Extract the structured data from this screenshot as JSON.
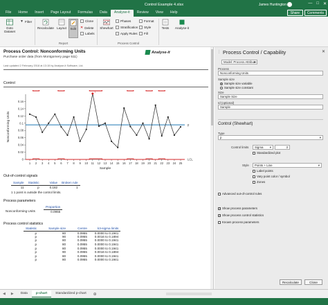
{
  "window": {
    "title": "Control Example 4.xlsx",
    "user": "James Huntington"
  },
  "ribbon_tabs": [
    "File",
    "Home",
    "Insert",
    "Page Layout",
    "Formulas",
    "Data",
    "Analyse-it",
    "Review",
    "View",
    "Help"
  ],
  "ribbon_share": "Share",
  "ribbon_comments": "Comments",
  "ribbon": {
    "goto_dataset": "Goto Dataset",
    "filter": "Filter",
    "recalculate": "Recalculate",
    "layout": "Layout",
    "edit": "Edit",
    "clone": "Clone",
    "delete": "Delete",
    "labels": "Labels",
    "report_group": "Report",
    "shewhart": "Shewhart",
    "phases": "Phases",
    "stratification": "Stratification",
    "apply_rules": "Apply Rules",
    "format": "Format",
    "style": "Style",
    "fill": "Fill",
    "process_control_group": "Process Control",
    "tests": "Tests",
    "analyse_it": "Analyse-it"
  },
  "report": {
    "title": "Process Control: Nonconforming Units",
    "subtitle": "Purchase order data (from Montgomery page 511)",
    "updated": "Last updated 2 February 2018 at 13:15 by Analyse-it Software, Ltd.",
    "logo": "Analyse-it",
    "section_control": "Control",
    "section_signals": "Out-of-control signals",
    "section_params": "Process parameters",
    "section_stats": "Process control statistics"
  },
  "chart_data": {
    "type": "line",
    "ylabel": "Nonconforming Units",
    "xlabel": "Sample",
    "ylim": [
      0,
      0.18
    ],
    "yticks": [
      0,
      0.02,
      0.04,
      0.06,
      0.08,
      0.1,
      0.12,
      0.14,
      0.16
    ],
    "xticks": [
      1,
      2,
      3,
      4,
      5,
      6,
      7,
      8,
      9,
      10,
      11,
      12,
      13,
      14,
      15,
      16,
      17,
      18,
      19,
      20,
      21,
      22,
      23,
      24,
      25
    ],
    "x": [
      1,
      2,
      3,
      4,
      5,
      6,
      7,
      8,
      9,
      10,
      11,
      12,
      13,
      14,
      15,
      16,
      17,
      18,
      19,
      20,
      21,
      22,
      23,
      24,
      25
    ],
    "values": [
      0.125,
      0.117,
      0.075,
      0.1,
      0.125,
      0.09,
      0.067,
      0.117,
      0.05,
      0.083,
      0.182,
      0.092,
      0.1,
      0.05,
      0.033,
      0.142,
      0.091,
      0.067,
      0.1,
      0.057,
      0.15,
      0.065,
      0.117,
      0.067,
      0.09
    ],
    "centre": 0.0955,
    "ucl": [
      0.1941,
      0.1894,
      0.1941,
      0.1941,
      0.1941,
      0.1894,
      0.1941,
      0.1941,
      0.1941,
      0.1941,
      0.1894,
      0.1894,
      0.1941,
      0.1941,
      0.1941,
      0.1941,
      0.1894,
      0.1941,
      0.1941,
      0.1894,
      0.1941,
      0.1894,
      0.1941,
      0.1941,
      0.1941
    ],
    "lcl": [
      0.0,
      0.0016,
      0.0,
      0.0,
      0.0,
      0.0016,
      0.0,
      0.0,
      0.0,
      0.0,
      0.0016,
      0.0016,
      0.0,
      0.0,
      0.0,
      0.0,
      0.0016,
      0.0,
      0.0,
      0.0016,
      0.0,
      0.0016,
      0.0,
      0.0,
      0.0
    ],
    "labels": {
      "ucl": "UCL",
      "centre": "p",
      "lcl": "LCL"
    },
    "out_of_control_points": [
      11
    ],
    "colors": {
      "data": "#222222",
      "centre": "#1f78b4",
      "limits": "#d62728"
    },
    "grid": false
  },
  "signals_table": {
    "headers": [
      "Sample",
      "Statistic",
      "Value",
      "Broken rule"
    ],
    "rows": [
      [
        "11",
        "p",
        "0.182",
        "1"
      ]
    ],
    "footnote": "1  1 point is outside the control limits."
  },
  "params_table": {
    "headers": [
      "",
      "Proportion"
    ],
    "rows": [
      [
        "Nonconforming Units",
        "0.0955"
      ]
    ]
  },
  "stats_table": {
    "headers": [
      "Statistic",
      "Sample size",
      "Centre",
      "k3-sigma limits"
    ],
    "rows": [
      [
        "p",
        "80",
        "0.0955",
        "0.0000 to 0.1941"
      ],
      [
        "p",
        "90",
        "0.0955",
        "0.0016 to 0.1894"
      ],
      [
        "p",
        "80",
        "0.0955",
        "0.0000 to 0.1941"
      ],
      [
        "p",
        "80",
        "0.0955",
        "0.0000 to 0.1941"
      ],
      [
        "p",
        "80",
        "0.0955",
        "0.0000 to 0.1941"
      ],
      [
        "p",
        "90",
        "0.0955",
        "0.0016 to 0.1894"
      ],
      [
        "p",
        "80",
        "0.0955",
        "0.0000 to 0.1941"
      ],
      [
        "p",
        "80",
        "0.0955",
        "0.0000 to 0.1941"
      ]
    ]
  },
  "sheets": [
    "Data",
    "p-chart",
    "Standardized p-chart"
  ],
  "active_sheet": "p-chart",
  "pane": {
    "title": "Process Control / Capability",
    "model": "Model: Process Attribute",
    "process_label": "Process",
    "process_value": "Nonconforming Units",
    "sample_size_label": "Sample size",
    "sample_variable": "Sample size variable",
    "sample_constant": "Sample size constant",
    "size_label": "Size",
    "size_value": "Sample Size",
    "id_label": "Id (optional)",
    "id_value": "Sample",
    "control_section": "Control (Shewhart)",
    "type_label": "Type",
    "type_value": "p",
    "limits_label": "Control limits",
    "limits_value": "Sigma",
    "limits_k": "3",
    "standardized": "Standardized plot",
    "style_label": "Style",
    "style_value": "Points + Line",
    "label_points": "Label points",
    "vary_color": "Vary point color / symbol",
    "zones": "Zones",
    "advanced_rules": "Advanced out-of-control rules",
    "show_params": "Show process parameters",
    "show_stats": "Show process control statistics",
    "known_params": "Known process parameters",
    "recalculate": "Recalculate",
    "close": "Close"
  }
}
